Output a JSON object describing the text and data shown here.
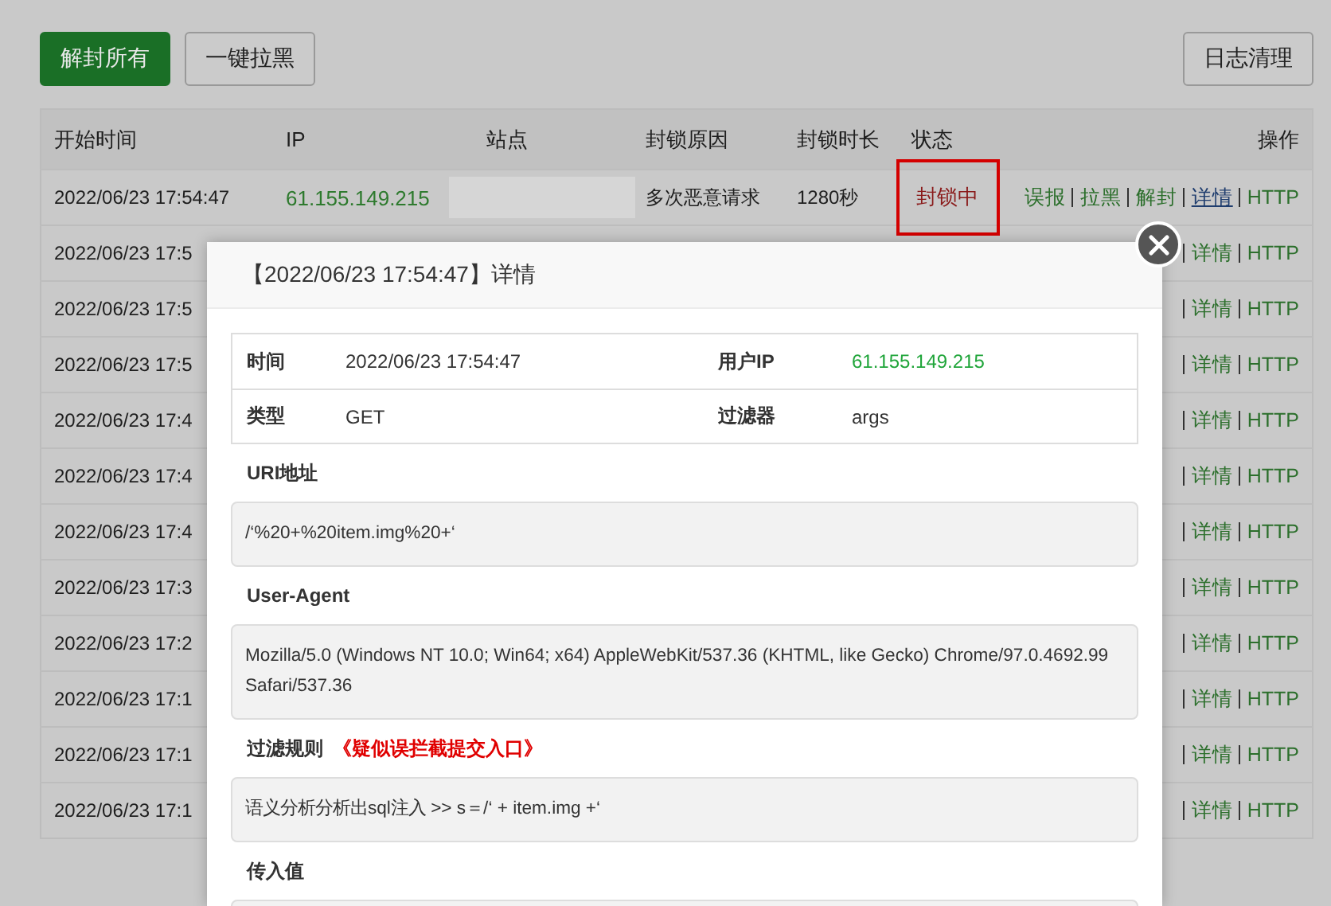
{
  "toolbar": {
    "left_buttons": [
      {
        "label": "解封所有",
        "kind": "primary"
      },
      {
        "label": "一键拉黑",
        "kind": "default"
      }
    ],
    "right_buttons": [
      {
        "label": "日志清理",
        "kind": "default"
      }
    ]
  },
  "table": {
    "columns": [
      "开始时间",
      "IP",
      "站点",
      "封锁原因",
      "封锁时长",
      "状态",
      "操作"
    ],
    "rows": [
      {
        "time": "2022/06/23 17:54:47",
        "ip": "61.155.149.215",
        "site_blurred": true,
        "reason": "多次恶意请求",
        "duration": "1280秒",
        "status": "封锁中",
        "highlighted": true,
        "actions": [
          {
            "label": "误报",
            "underlined": false
          },
          {
            "label": "拉黑",
            "underlined": false
          },
          {
            "label": "解封",
            "underlined": false
          },
          {
            "label": "详情",
            "underlined": true
          },
          {
            "label": "HTTP",
            "underlined": false
          }
        ]
      },
      {
        "time": "2022/06/23 17:5",
        "actions": [
          {
            "label": "详情",
            "underlined": false
          },
          {
            "label": "HTTP",
            "underlined": false
          }
        ]
      },
      {
        "time": "2022/06/23 17:5",
        "actions": [
          {
            "label": "详情",
            "underlined": false
          },
          {
            "label": "HTTP",
            "underlined": false
          }
        ]
      },
      {
        "time": "2022/06/23 17:5",
        "actions": [
          {
            "label": "详情",
            "underlined": false
          },
          {
            "label": "HTTP",
            "underlined": false
          }
        ]
      },
      {
        "time": "2022/06/23 17:4",
        "actions": [
          {
            "label": "详情",
            "underlined": false
          },
          {
            "label": "HTTP",
            "underlined": false
          }
        ]
      },
      {
        "time": "2022/06/23 17:4",
        "actions": [
          {
            "label": "详情",
            "underlined": false
          },
          {
            "label": "HTTP",
            "underlined": false
          }
        ]
      },
      {
        "time": "2022/06/23 17:4",
        "actions": [
          {
            "label": "详情",
            "underlined": false
          },
          {
            "label": "HTTP",
            "underlined": false
          }
        ]
      },
      {
        "time": "2022/06/23 17:3",
        "actions": [
          {
            "label": "详情",
            "underlined": false
          },
          {
            "label": "HTTP",
            "underlined": false
          }
        ]
      },
      {
        "time": "2022/06/23 17:2",
        "actions": [
          {
            "label": "详情",
            "underlined": false
          },
          {
            "label": "HTTP",
            "underlined": false
          }
        ]
      },
      {
        "time": "2022/06/23 17:1",
        "actions": [
          {
            "label": "详情",
            "underlined": false
          },
          {
            "label": "HTTP",
            "underlined": false
          }
        ]
      },
      {
        "time": "2022/06/23 17:1",
        "actions": [
          {
            "label": "详情",
            "underlined": false
          },
          {
            "label": "HTTP",
            "underlined": false
          }
        ]
      },
      {
        "time": "2022/06/23 17:1",
        "actions": [
          {
            "label": "详情",
            "underlined": false
          },
          {
            "label": "HTTP",
            "underlined": false
          }
        ]
      }
    ]
  },
  "dialog": {
    "title": "【2022/06/23 17:54:47】详情",
    "info": [
      {
        "label": "时间",
        "value": "2022/06/23 17:54:47",
        "kind": "plain"
      },
      {
        "label": "用户IP",
        "value": "61.155.149.215",
        "kind": "ip"
      },
      {
        "label": "类型",
        "value": "GET",
        "kind": "plain"
      },
      {
        "label": "过滤器",
        "value": "args",
        "kind": "plain"
      }
    ],
    "sections": [
      {
        "label": "URI地址",
        "value": "/‘%20+%20item.img%20+‘"
      },
      {
        "label": "User-Agent",
        "value": "Mozilla/5.0 (Windows NT 10.0; Win64; x64) AppleWebKit/537.36 (KHTML, like Gecko) Chrome/97.0.4692.99 Safari/537.36"
      },
      {
        "label": "过滤规则",
        "note": "《疑似误拦截提交入口》",
        "value": "语义分析分析出sql注入 >> s＝/‘ + item.img +‘"
      },
      {
        "label": "传入值"
      }
    ]
  }
}
